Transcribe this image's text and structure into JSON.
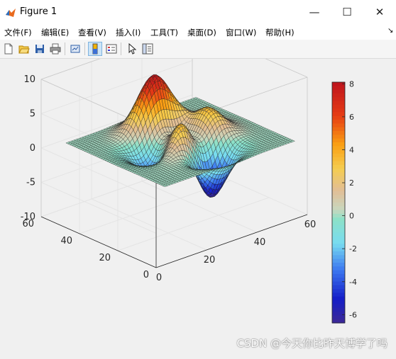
{
  "window": {
    "title": "Figure 1",
    "minimize_glyph": "—",
    "maximize_glyph": "☐",
    "close_glyph": "✕"
  },
  "menu": {
    "items": [
      "文件(F)",
      "编辑(E)",
      "查看(V)",
      "插入(I)",
      "工具(T)",
      "桌面(D)",
      "窗口(W)",
      "帮助(H)"
    ],
    "dock_glyph": "↘"
  },
  "toolbar": {
    "icons": [
      "new-figure-icon",
      "open-file-icon",
      "save-icon",
      "print-icon",
      "link-plot-icon",
      "colorbar-icon",
      "legend-icon",
      "edit-plot-arrow-icon",
      "property-inspector-icon"
    ]
  },
  "chart_data": {
    "type": "surface",
    "function": "peaks",
    "grid_size": 49,
    "xlim": [
      0,
      60
    ],
    "ylim": [
      0,
      60
    ],
    "zlim": [
      -10,
      10
    ],
    "xticks": [
      "0",
      "20",
      "40",
      "60"
    ],
    "yticks": [
      "0",
      "20",
      "40",
      "60"
    ],
    "zticks": [
      "10",
      "5",
      "0",
      "-5",
      "-10"
    ],
    "colorbar": {
      "ticks": [
        "8",
        "6",
        "4",
        "2",
        "0",
        "-2",
        "-4",
        "-6"
      ],
      "range": [
        -6.5,
        8.1
      ],
      "colormap": "jet-like with light band near zero"
    },
    "grid": true
  },
  "watermark": "CSDN @今天你比昨天博学了吗"
}
